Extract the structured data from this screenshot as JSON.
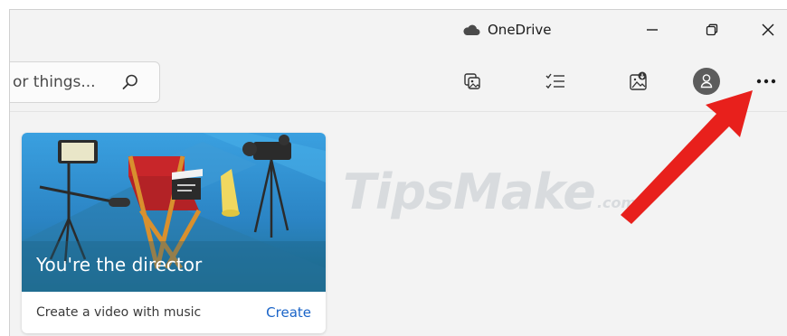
{
  "titlebar": {
    "app_name": "OneDrive",
    "cloud_icon": "cloud-icon",
    "minimize_icon": "minimize-icon",
    "restore_icon": "restore-icon",
    "close_icon": "close-icon"
  },
  "toolbar": {
    "search_text": "or things...",
    "search_icon": "search-icon",
    "tools": [
      "slideshow-icon",
      "select-icon",
      "import-icon",
      "account-icon",
      "more-options-icon"
    ],
    "more_label": "..."
  },
  "card": {
    "title": "You're the director",
    "description": "Create a video with music",
    "action_label": "Create"
  },
  "watermark": {
    "brand": "TipsMake",
    "suffix": ".com"
  },
  "colors": {
    "accent": "#1a64c8",
    "arrow": "#e8201c",
    "card_bg_top": "#2f8fd6",
    "card_bg_bottom": "#1f6f8c"
  }
}
